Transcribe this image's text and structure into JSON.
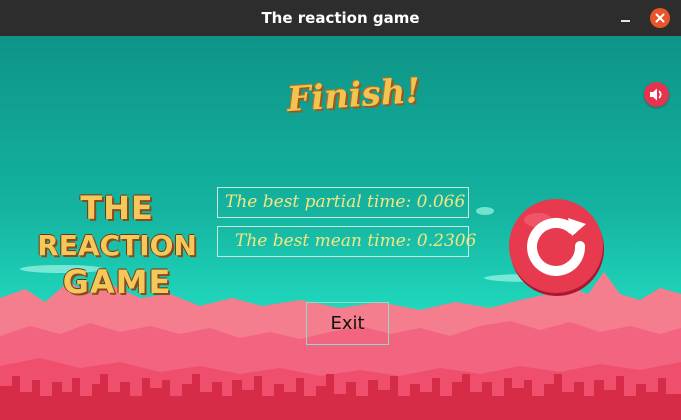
{
  "window": {
    "title": "The reaction game",
    "minimize_icon": "minimize-icon",
    "close_icon": "close-icon"
  },
  "game": {
    "heading": "Finish!",
    "logo": {
      "line1": "THE",
      "line2": "REACTION",
      "line3": "GAME"
    },
    "stats": {
      "best_partial": "The best partial time: 0.066",
      "best_mean": "The best mean time: 0.2306"
    },
    "exit_label": "Exit",
    "sound_icon": "speaker-icon",
    "restart_icon": "restart-icon"
  },
  "colors": {
    "sky_top": "#0e9487",
    "sky_bottom": "#22dcc0",
    "mountains_back": "#f27a8c",
    "mountains_front": "#f26480",
    "city": "#d62c47",
    "restart_red": "#e83a4f",
    "stat_text": "#f3e682",
    "logo_gold": "#f4c85a"
  }
}
